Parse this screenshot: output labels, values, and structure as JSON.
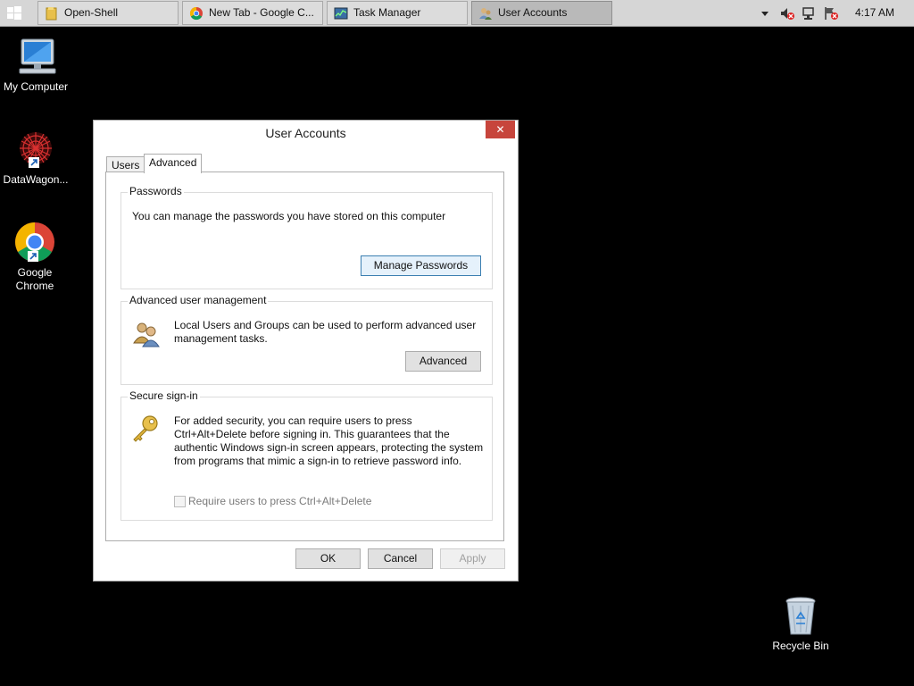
{
  "taskbar": {
    "buttons": [
      {
        "label": "Open-Shell",
        "icon": "folder-icon"
      },
      {
        "label": "New Tab - Google C...",
        "icon": "chrome-icon"
      },
      {
        "label": "Task Manager",
        "icon": "task-manager-icon"
      },
      {
        "label": "User Accounts",
        "icon": "user-accounts-icon",
        "active": true
      }
    ],
    "clock": "4:17 AM"
  },
  "desktop": {
    "icons": [
      {
        "label": "My Computer",
        "icon": "computer-icon"
      },
      {
        "label": "DataWagon...",
        "icon": "datawagon-icon"
      },
      {
        "label": "Google Chrome",
        "icon": "chrome-icon"
      },
      {
        "label": "Recycle Bin",
        "icon": "recycle-bin-icon"
      }
    ]
  },
  "dialog": {
    "title": "User Accounts",
    "close_label": "✕",
    "tabs": [
      {
        "label": "Users"
      },
      {
        "label": "Advanced",
        "selected": true
      }
    ],
    "passwords": {
      "title": "Passwords",
      "text": "You can manage the passwords you have stored on this computer",
      "button": "Manage Passwords"
    },
    "advanced": {
      "title": "Advanced user management",
      "text": "Local Users and Groups can be used to perform advanced user management tasks.",
      "button": "Advanced"
    },
    "secure": {
      "title": "Secure sign-in",
      "text": "For added security, you can require users to press Ctrl+Alt+Delete before signing in. This guarantees that the authentic Windows sign-in screen appears, protecting the system from programs that mimic a sign-in to retrieve password info.",
      "checkbox_label": "Require users to press Ctrl+Alt+Delete",
      "checkbox_checked": false
    },
    "buttons": {
      "ok": "OK",
      "cancel": "Cancel",
      "apply": "Apply"
    }
  }
}
